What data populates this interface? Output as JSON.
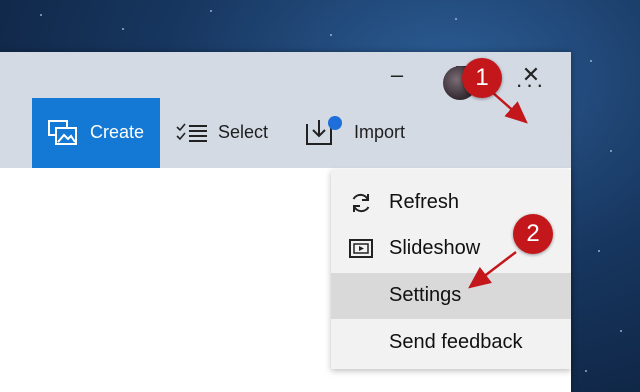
{
  "window": {
    "controls": {
      "minimize": "–",
      "maximize": "☐",
      "close": "✕"
    }
  },
  "toolbar": {
    "create_label": "Create",
    "select_label": "Select",
    "import_label": "Import",
    "more_label": "···",
    "accent_color": "#1479d4",
    "notification_color": "#1e6fd9"
  },
  "menu": {
    "items": [
      {
        "label": "Refresh",
        "icon": "refresh-icon"
      },
      {
        "label": "Slideshow",
        "icon": "slideshow-icon"
      },
      {
        "label": "Settings",
        "icon": ""
      },
      {
        "label": "Send feedback",
        "icon": ""
      }
    ],
    "highlighted": "Settings"
  },
  "annotations": {
    "step1": "1",
    "step2": "2",
    "color": "#c3171c"
  }
}
